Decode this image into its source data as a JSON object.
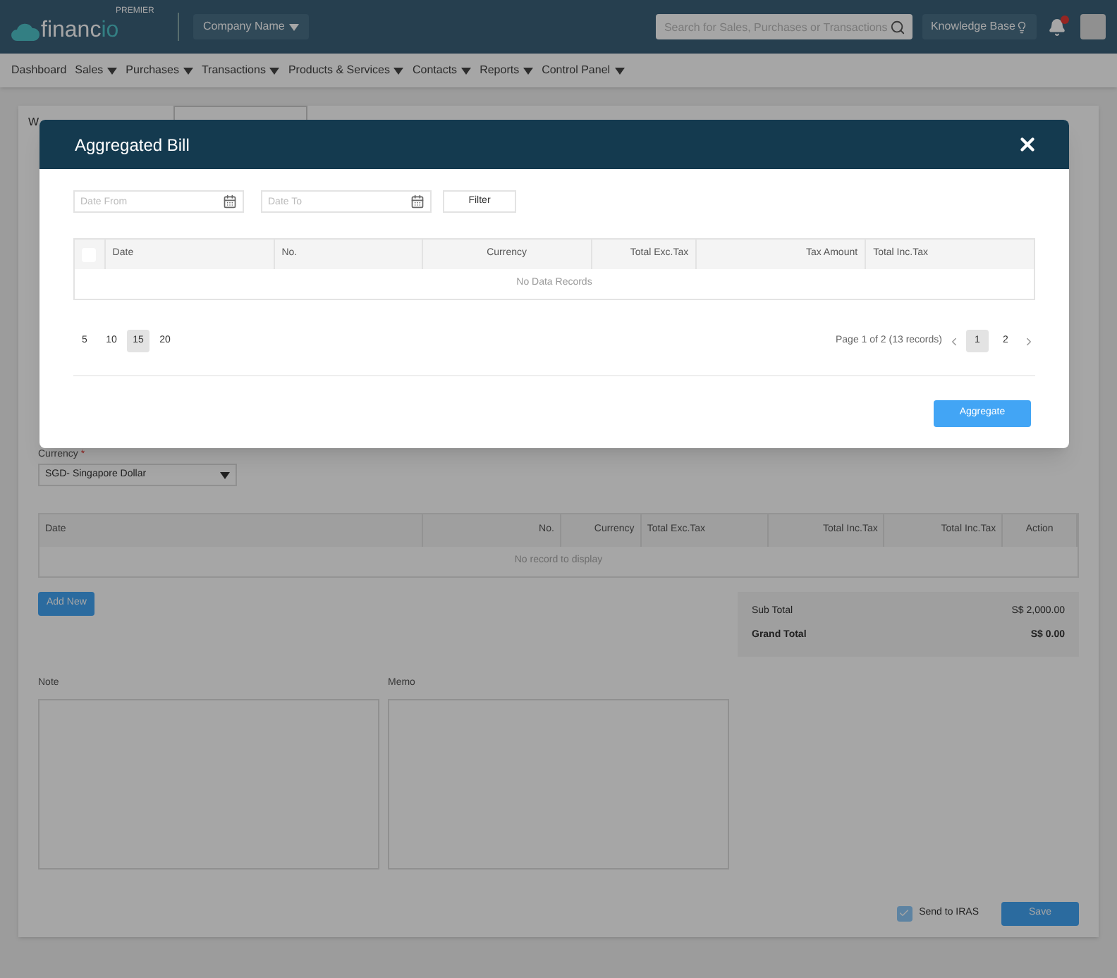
{
  "header": {
    "logo": {
      "text": "financ",
      "accent": "io"
    },
    "badge": "PREMIER",
    "company": "Company Name",
    "search": {
      "placeholder": "Search for Sales, Purchases or Transactions"
    },
    "knowledge_base": "Knowledge Base"
  },
  "nav": [
    {
      "label": "Dashboard",
      "dropdown": false
    },
    {
      "label": "Sales",
      "dropdown": true
    },
    {
      "label": "Purchases",
      "dropdown": true
    },
    {
      "label": "Transactions",
      "dropdown": true
    },
    {
      "label": "Products & Services",
      "dropdown": true
    },
    {
      "label": "Contacts",
      "dropdown": true
    },
    {
      "label": "Reports",
      "dropdown": true
    },
    {
      "label": "Control Panel",
      "dropdown": true
    }
  ],
  "form": {
    "tab": "W",
    "currency": {
      "label": "Currency",
      "required_mark": "*",
      "value": "SGD- Singapore Dollar"
    },
    "table": {
      "columns": [
        "Date",
        "No.",
        "Currency",
        "Total Exc.Tax",
        "Total Inc.Tax",
        "Total Inc.Tax",
        "Action"
      ],
      "empty": "No record to display"
    },
    "add_button": "Add New",
    "totals": [
      {
        "label": "Sub Total",
        "value": "S$ 2,000.00",
        "bold": false
      },
      {
        "label": "Grand Total",
        "value": "S$ 0.00",
        "bold": true
      }
    ],
    "note": {
      "label": "Note"
    },
    "memo": {
      "label": "Memo"
    },
    "send_to_iras": {
      "label": "Send to IRAS",
      "checked": true
    },
    "save_button": "Save"
  },
  "modal": {
    "title": "Aggregated Bill",
    "date_from": {
      "placeholder": "Date From"
    },
    "date_to": {
      "placeholder": "Date To"
    },
    "filter_button": "Filter",
    "table": {
      "select_all": {
        "checked": false
      },
      "columns": [
        "Date",
        "No.",
        "Currency",
        "Total Exc.Tax",
        "Tax Amount",
        "Total Inc.Tax"
      ],
      "empty": "No Data Records"
    },
    "page_sizes": [
      {
        "label": "5",
        "selected": false
      },
      {
        "label": "10",
        "selected": false
      },
      {
        "label": "15",
        "selected": true
      },
      {
        "label": "20",
        "selected": false
      }
    ],
    "page_info": "Page 1 of 2 (13 records)",
    "pages": [
      {
        "label": "1",
        "selected": true
      },
      {
        "label": "2",
        "selected": false
      }
    ],
    "aggregate_button": "Aggregate"
  }
}
